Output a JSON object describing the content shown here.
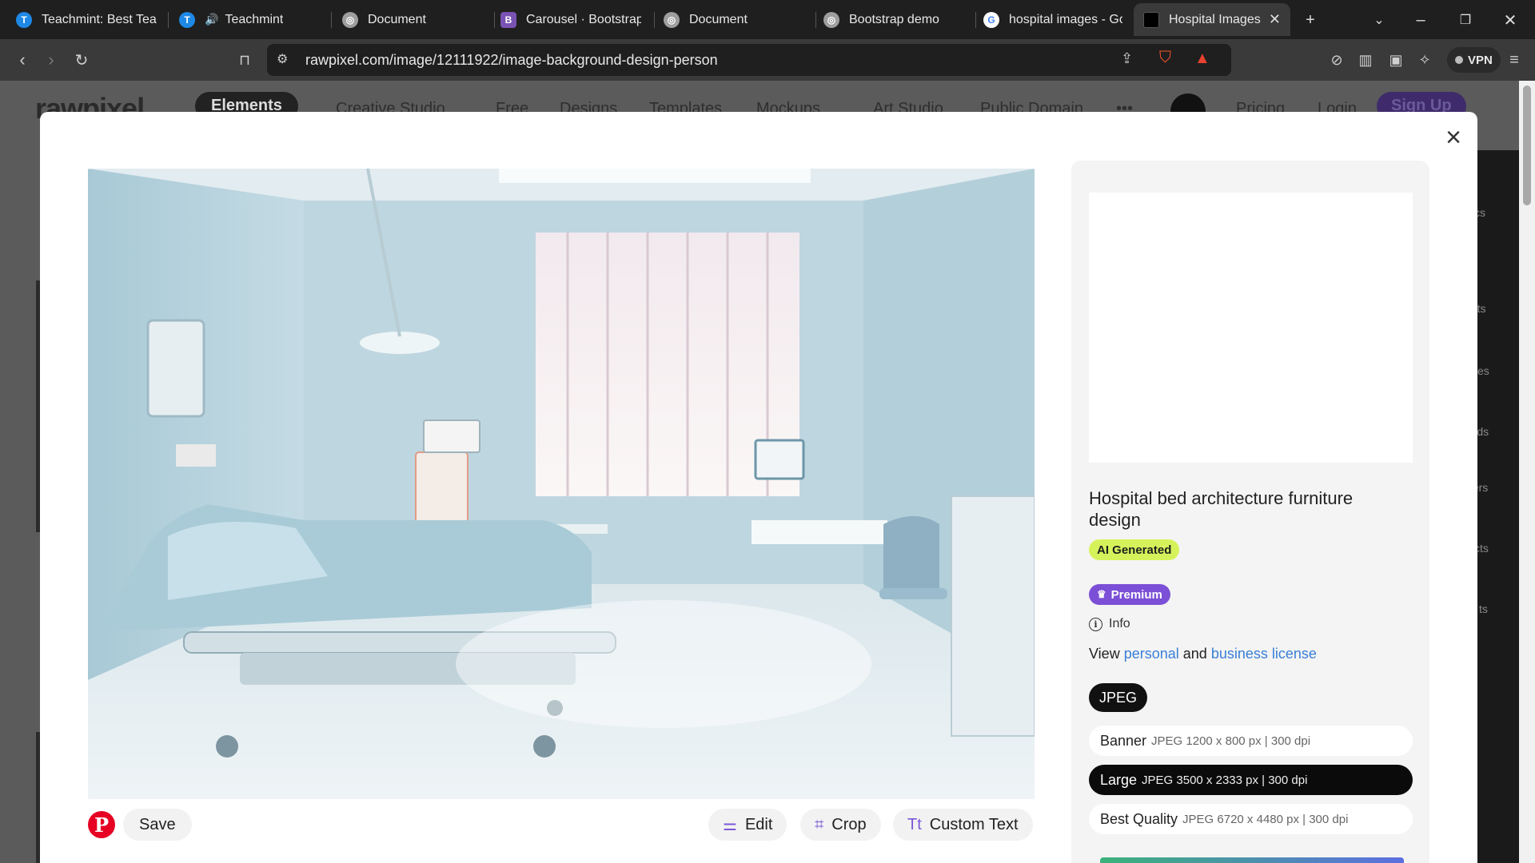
{
  "browser": {
    "tabs": [
      {
        "label": "Teachmint: Best Teach",
        "icon": "teachmint-icon",
        "color": "#1e88e5",
        "glyph": "T",
        "active": false
      },
      {
        "label": "Teachmint",
        "icon": "teachmint-icon",
        "color": "#1e88e5",
        "glyph": "T",
        "active": false
      },
      {
        "label": "Document",
        "icon": "globe-icon",
        "color": "#9e9e9e",
        "glyph": "",
        "active": false
      },
      {
        "label": "Carousel · Bootstrap v",
        "icon": "bootstrap-icon",
        "color": "#7952b3",
        "glyph": "B",
        "active": false
      },
      {
        "label": "Document",
        "icon": "globe-icon",
        "color": "#9e9e9e",
        "glyph": "",
        "active": false
      },
      {
        "label": "Bootstrap demo",
        "icon": "globe-icon",
        "color": "#9e9e9e",
        "glyph": "",
        "active": false
      },
      {
        "label": "hospital images - Goo",
        "icon": "google-icon",
        "color": "#ffffff",
        "glyph": "G",
        "active": false
      },
      {
        "label": "Hospital Images",
        "icon": "rawpixel-icon",
        "color": "#000000",
        "glyph": "",
        "active": true
      }
    ],
    "url": "rawpixel.com/image/12111922/image-background-design-person",
    "vpn_label": "VPN"
  },
  "background_page": {
    "logo": "rawpixel",
    "elements_label": "Elements",
    "nav": [
      "Creative Studio",
      "Free",
      "Designs",
      "Templates",
      "Mockups",
      "Art Studio",
      "Public Domain",
      "•••"
    ],
    "pricing": "Pricing",
    "login": "Login",
    "signup": "Sign Up",
    "sidebar_items": [
      "cs",
      "ents",
      "es",
      "ounds",
      "pers",
      "cts",
      "ts"
    ]
  },
  "modal": {
    "title": "Hospital bed architecture furniture design",
    "ai_badge": "AI Generated",
    "premium_badge": "Premium",
    "info_label": "Info",
    "license": {
      "prefix": "View",
      "personal": "personal",
      "and": "and",
      "business": "business license"
    },
    "format": "JPEG",
    "sizes": [
      {
        "name": "Banner",
        "detail": "JPEG 1200 x 800 px | 300 dpi",
        "selected": false
      },
      {
        "name": "Large",
        "detail": "JPEG 3500 x 2333 px | 300 dpi",
        "selected": true
      },
      {
        "name": "Best Quality",
        "detail": "JPEG 6720 x 4480 px | 300 dpi",
        "selected": false
      }
    ],
    "actions": {
      "save": "Save",
      "edit": "Edit",
      "crop": "Crop",
      "custom_text": "Custom Text"
    }
  },
  "colors": {
    "premium": "#7b4fd6",
    "ai_badge": "#d6f25b",
    "link": "#3a7fd6",
    "pinterest": "#e60023"
  }
}
